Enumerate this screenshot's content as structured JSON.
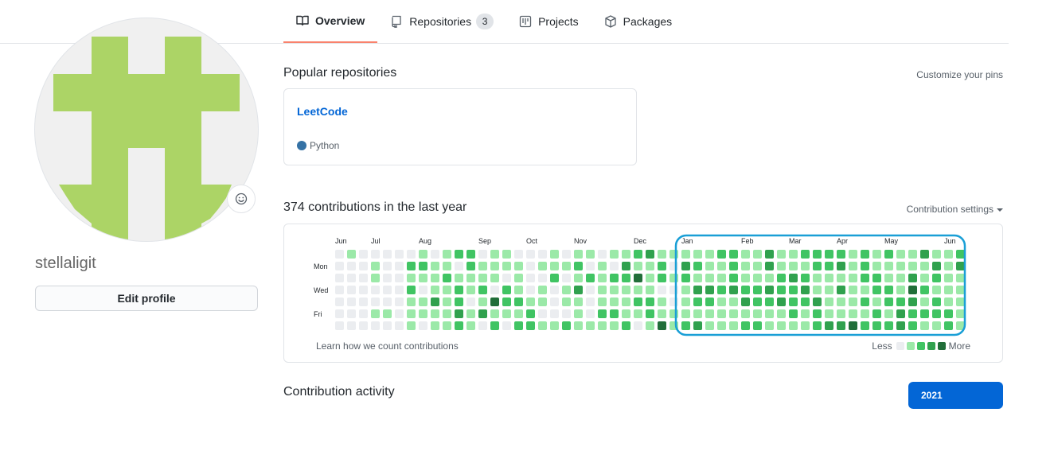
{
  "tabs": [
    {
      "label": "Overview",
      "icon": "book-icon",
      "selected": true
    },
    {
      "label": "Repositories",
      "icon": "repo-icon",
      "count": "3"
    },
    {
      "label": "Projects",
      "icon": "project-icon"
    },
    {
      "label": "Packages",
      "icon": "package-icon"
    }
  ],
  "profile": {
    "username": "stellaligit",
    "edit_label": "Edit profile",
    "avatar_color": "#acd466"
  },
  "pinned": {
    "title": "Popular repositories",
    "customize_label": "Customize your pins",
    "repos": [
      {
        "name": "LeetCode",
        "language": "Python",
        "language_color": "#3572A5"
      }
    ]
  },
  "contributions": {
    "title": "374 contributions in the last year",
    "settings_label": "Contribution settings",
    "months": [
      "Jun",
      "Jul",
      "Aug",
      "Sep",
      "Oct",
      "Nov",
      "Dec",
      "Jan",
      "Feb",
      "Mar",
      "Apr",
      "May",
      "Jun"
    ],
    "days": [
      "Mon",
      "Wed",
      "Fri"
    ],
    "learn_label": "Learn how we count contributions",
    "less_label": "Less",
    "more_label": "More",
    "level_colors": [
      "#ebedf0",
      "#9be9a8",
      "#40c463",
      "#30a14e",
      "#216e39"
    ],
    "highlight_color": "#1a9fd6"
  },
  "activity": {
    "title": "Contribution activity",
    "year": "2021"
  }
}
